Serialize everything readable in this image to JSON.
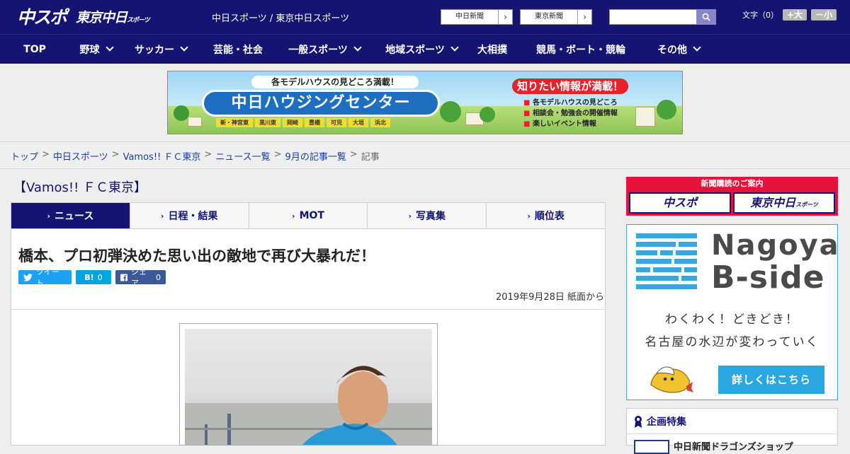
{
  "header": {
    "logo_main": "中スポ",
    "logo_tokyo": "東京中日",
    "logo_tokyo_sub": "スポーツ",
    "site_name": "中日スポーツ / 東京中日スポーツ",
    "paper_links": [
      "中日新聞",
      "東京新聞"
    ],
    "search_placeholder": "",
    "font_size_label": "文字（0）",
    "font_larger": "+大",
    "font_smaller": "－小"
  },
  "nav": {
    "items": [
      {
        "label": "TOP",
        "dropdown": false
      },
      {
        "label": "野球",
        "dropdown": true
      },
      {
        "label": "サッカー",
        "dropdown": true
      },
      {
        "label": "芸能・社会",
        "dropdown": false
      },
      {
        "label": "一般スポーツ",
        "dropdown": true
      },
      {
        "label": "地域スポーツ",
        "dropdown": true
      },
      {
        "label": "大相撲",
        "dropdown": false
      },
      {
        "label": "競馬・ボート・競輪",
        "dropdown": false
      },
      {
        "label": "その他",
        "dropdown": true
      }
    ]
  },
  "banner": {
    "top": "各モデルハウスの見どころ満載！",
    "main": "中日ハウジングセンター",
    "areas": [
      "新・神宮東",
      "黒川東",
      "岡崎",
      "豊橋",
      "可児",
      "大垣",
      "浜北"
    ],
    "right_title": "知りたい情報が満載！",
    "right_items": [
      "各モデルハウスの見どころ",
      "相談会・勉強会の開催情報",
      "楽しいイベント情報"
    ]
  },
  "breadcrumb": {
    "links": [
      "トップ",
      "中日スポーツ",
      "Vamos!! ＦＣ東京",
      "ニュース一覧",
      "9月の記事一覧"
    ],
    "current": "記事",
    "separator": ">"
  },
  "section": {
    "title": "【Vamos!! ＦＣ東京】",
    "tabs": [
      {
        "label": "ニュース",
        "active": true
      },
      {
        "label": "日程・結果",
        "active": false
      },
      {
        "label": "MOT",
        "active": false
      },
      {
        "label": "写真集",
        "active": false
      },
      {
        "label": "順位表",
        "active": false
      }
    ]
  },
  "article": {
    "headline": "橋本、プロ初弾決めた思い出の敵地で再び大暴れだ！",
    "share": {
      "tweet": "ツイート",
      "hatena_label": "B!",
      "hatena_count": "0",
      "facebook_label": "シェア",
      "facebook_count": "0"
    },
    "date": "2019年9月28日 紙面から"
  },
  "sidebar": {
    "subscription": {
      "caption": "新聞購読のご案内",
      "left": "中スポ",
      "right": "東京中日",
      "right_sub": "スポーツ"
    },
    "nagoya_ad": {
      "title1": "Nagoya",
      "title2": "B-side",
      "copy1": "わくわく！どきどき！",
      "copy2": "名古屋の水辺が変わっていく",
      "button": "詳しくはこちら"
    },
    "kikaku": {
      "heading": "企画特集",
      "first_item": "中日新聞ドラゴンズショップ"
    }
  },
  "colors": {
    "navy": "#161473",
    "accent_blue": "#29a7e0",
    "subscription_red": "#e5123b",
    "twitter": "#1da1f2",
    "hatena": "#00a4de",
    "facebook": "#3b5998"
  }
}
